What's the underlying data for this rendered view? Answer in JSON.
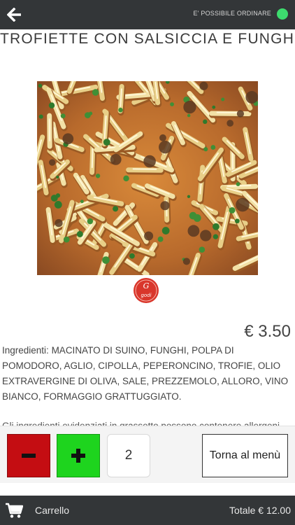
{
  "header": {
    "back_icon": "arrow-left-icon",
    "status_text": "E' POSSIBILE ORDINARE",
    "status_color": "#3ddc6e"
  },
  "product": {
    "title": "TROFIETTE CON SALSICCIA E FUNGHI",
    "image_desc_icon": "pasta-photo",
    "logo_text": "godi",
    "price": "€ 3.50",
    "ingredients_label": "Ingredienti:",
    "ingredients": "MACINATO DI SUINO, FUNGHI, POLPA DI POMODORO, AGLIO, CIPOLLA, PEPERONCINO, TROFIE, OLIO EXTRAVERGINE DI OLIVA, SALE, PREZZEMOLO, ALLORO, VINO BIANCO, FORMAGGIO GRATTUGGIATO.",
    "notes_partial": "Gli ingredienti evidenziati in grassetto possono contenere allergeni"
  },
  "controls": {
    "minus_label": "−",
    "plus_label": "+",
    "quantity": "2",
    "back_to_menu": "Torna al menù",
    "minus_color": "#c40d12",
    "plus_color": "#1ed41e"
  },
  "footer": {
    "cart_icon": "cart-icon",
    "cart_label": "Carrello",
    "total": "Totale € 12.00"
  }
}
